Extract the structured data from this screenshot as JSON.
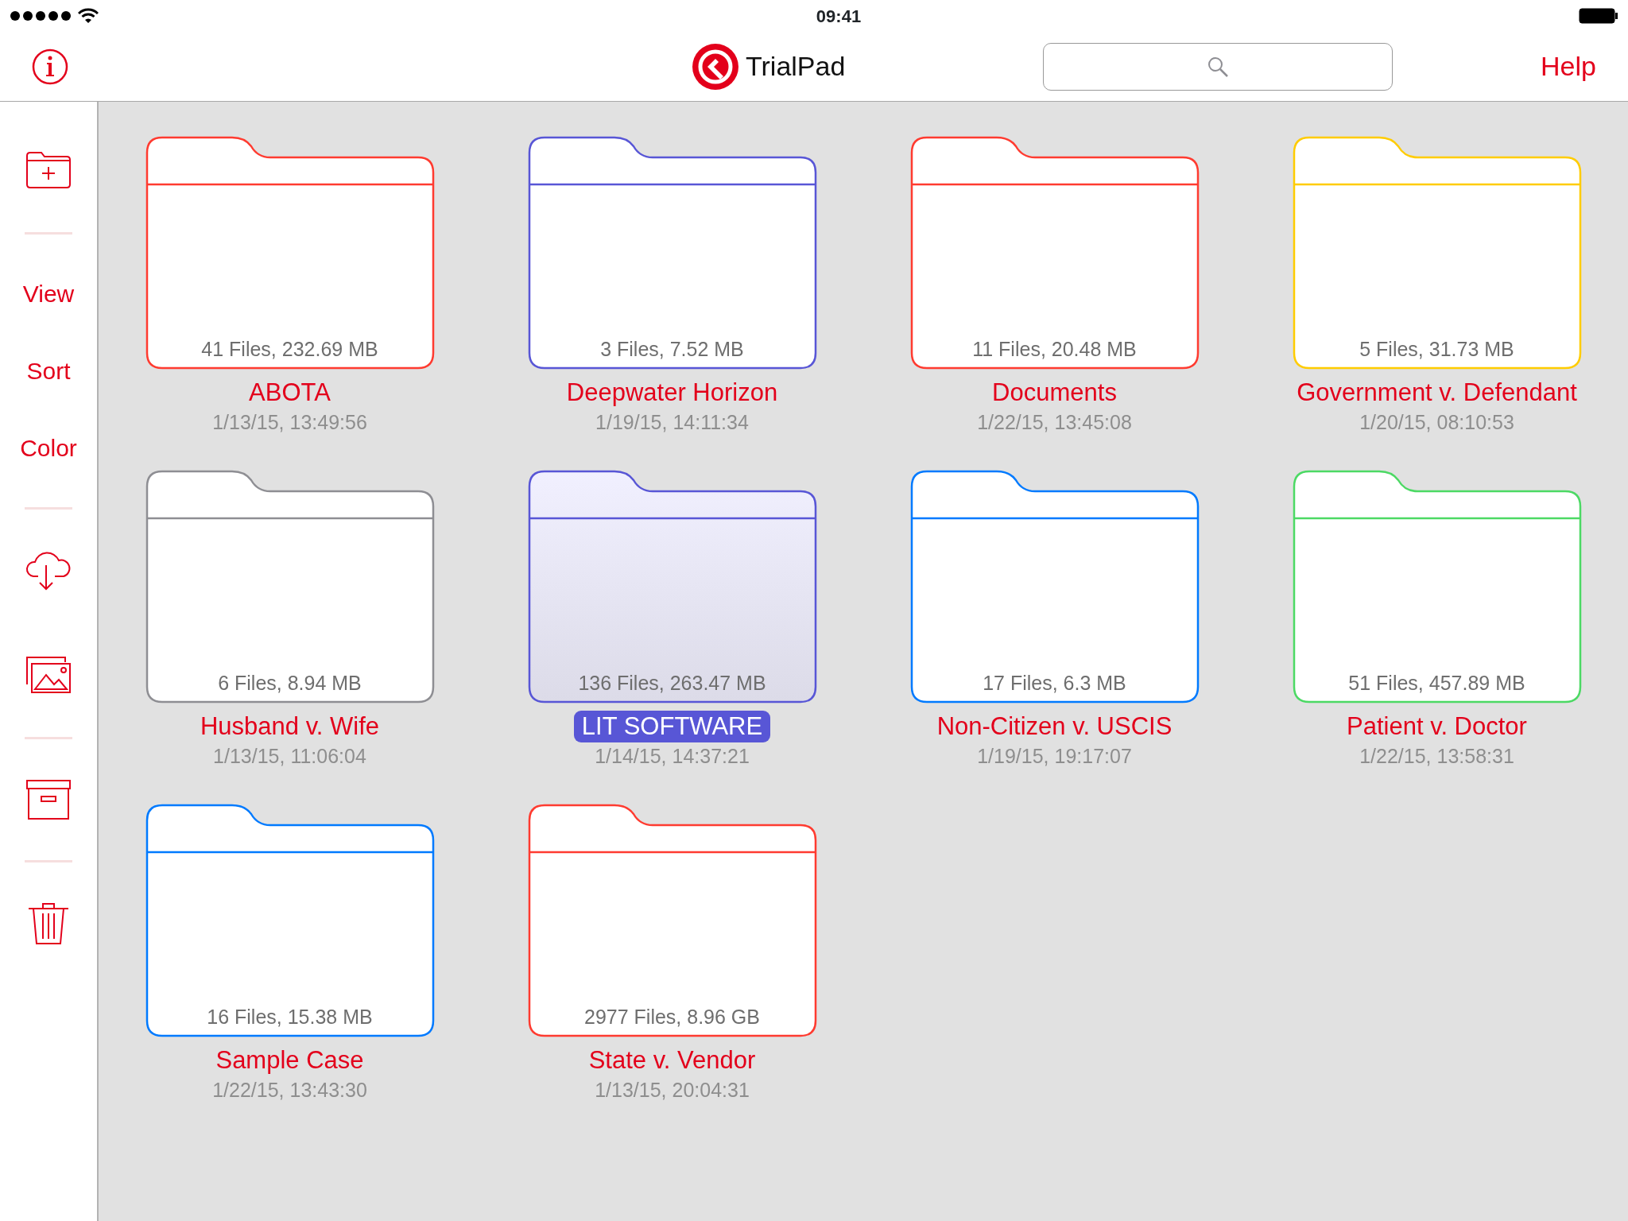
{
  "status_bar": {
    "time": "09:41"
  },
  "nav_bar": {
    "title": "TrialPad",
    "help": "Help"
  },
  "sidebar": {
    "groups": [
      [
        {
          "kind": "new_folder"
        }
      ],
      [
        {
          "kind": "text",
          "label": "View"
        },
        {
          "kind": "text",
          "label": "Sort"
        },
        {
          "kind": "text",
          "label": "Color"
        }
      ],
      [
        {
          "kind": "cloud"
        },
        {
          "kind": "photos"
        }
      ],
      [
        {
          "kind": "archive"
        }
      ],
      [
        {
          "kind": "trash"
        }
      ]
    ]
  },
  "folders": [
    {
      "name": "ABOTA",
      "info": "41 Files, 232.69 MB",
      "date": "1/13/15, 13:49:56",
      "color": "#ff3b30",
      "selected": false
    },
    {
      "name": "Deepwater Horizon",
      "info": "3 Files, 7.52 MB",
      "date": "1/19/15, 14:11:34",
      "color": "#5856d6",
      "selected": false
    },
    {
      "name": "Documents",
      "info": "11 Files, 20.48 MB",
      "date": "1/22/15, 13:45:08",
      "color": "#ff3b30",
      "selected": false
    },
    {
      "name": "Government v. Defendant",
      "info": "5 Files, 31.73 MB",
      "date": "1/20/15, 08:10:53",
      "color": "#ffcc00",
      "selected": false
    },
    {
      "name": "Husband v. Wife",
      "info": "6 Files, 8.94 MB",
      "date": "1/13/15, 11:06:04",
      "color": "#8e8e93",
      "selected": false
    },
    {
      "name": "LIT SOFTWARE",
      "info": "136 Files, 263.47 MB",
      "date": "1/14/15, 14:37:21",
      "color": "#5856d6",
      "selected": true
    },
    {
      "name": "Non-Citizen v. USCIS",
      "info": "17 Files, 6.3 MB",
      "date": "1/19/15, 19:17:07",
      "color": "#007aff",
      "selected": false
    },
    {
      "name": "Patient v. Doctor",
      "info": "51 Files, 457.89 MB",
      "date": "1/22/15, 13:58:31",
      "color": "#4cd964",
      "selected": false
    },
    {
      "name": "Sample Case",
      "info": "16 Files, 15.38 MB",
      "date": "1/22/15, 13:43:30",
      "color": "#007aff",
      "selected": false
    },
    {
      "name": "State v. Vendor",
      "info": "2977 Files, 8.96 GB",
      "date": "1/13/15, 20:04:31",
      "color": "#ff3b30",
      "selected": false
    }
  ]
}
